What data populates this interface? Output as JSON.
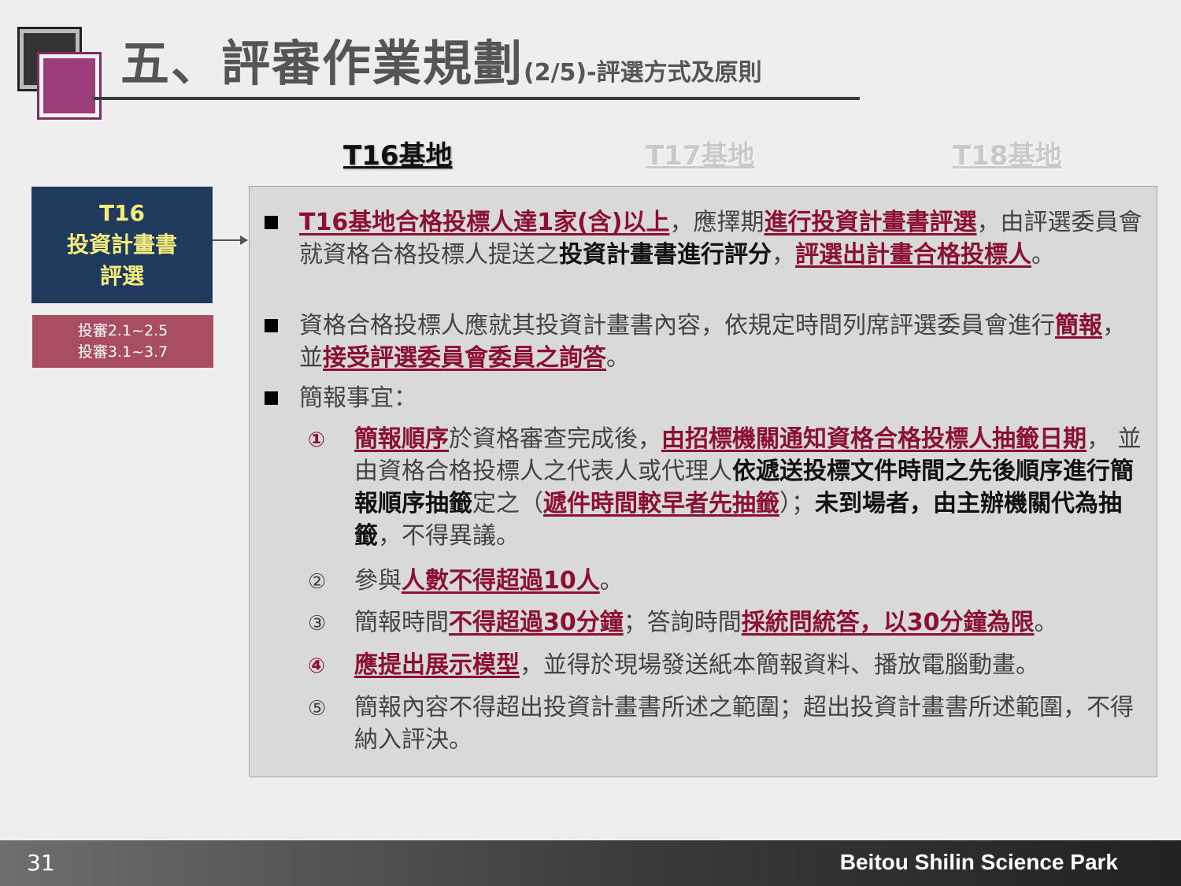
{
  "header": {
    "title_main": "五、評審作業規劃",
    "title_sub": "(2/5)-評選方式及原則"
  },
  "tabs": [
    {
      "label": "T16基地",
      "active": true
    },
    {
      "label": "T17基地",
      "active": false
    },
    {
      "label": "T18基地",
      "active": false
    }
  ],
  "stage": {
    "line1": "T16",
    "line2": "投資計畫書",
    "line3": "評選"
  },
  "refs": {
    "line1": "投審2.1~2.5",
    "line2": "投審3.1~3.7"
  },
  "bullets": {
    "b1": {
      "s1": "T16基地合格投標人達1家(含)以上",
      "s2": "，應擇期",
      "s3": "進行投資計畫書評選",
      "s4": "，由評選委員會就資格合格投標人提送之",
      "s5": "投資計畫書進行評分",
      "s6": "，",
      "s7": "評選出計畫合格投標人",
      "s8": "。"
    },
    "b2": {
      "s1": "資格合格投標人應就其投資計畫書內容，依規定時間列席評選委員會進行",
      "s2": "簡報",
      "s3": "，並",
      "s4": "接受評選委員會委員之詢答",
      "s5": "。"
    },
    "b3": {
      "s1": "簡報事宜："
    }
  },
  "items": [
    {
      "marker": "①",
      "s1": "簡報順序",
      "s2": "於資格審查完成後，",
      "s3": "由招標機關通知資格合格投標人抽籤日期",
      "s4": "，  並由資格合格投標人之代表人或代理人",
      "s5": "依遞送投標文件時間之先後順序進行簡報順序抽籤",
      "s6": "定之（",
      "s7": "遞件時間較早者先抽籤",
      "s8": "）；",
      "s9": "未到場者，由主辦機關代為抽籤",
      "s10": "，不得異議。"
    },
    {
      "marker": "②",
      "s1": "參與",
      "s2": "人數不得超過10人",
      "s3": "。"
    },
    {
      "marker": "③",
      "s1": "簡報時間",
      "s2": "不得超過30分鐘",
      "s3": "；答詢時間",
      "s4": "採統問統答，以30分鐘為限",
      "s5": "。"
    },
    {
      "marker": "④",
      "s1": "應提出展示模型",
      "s2": "，並得於現場發送紙本簡報資料、播放電腦動畫。"
    },
    {
      "marker": "⑤",
      "s1": "簡報內容不得超出投資計畫書所述之範圍；超出投資計畫書所述範圍，不得納入評決。"
    }
  ],
  "footer": {
    "page": "31",
    "brand": "Beitou Shilin Science Park"
  },
  "colors": {
    "accent_red": "#8b1033",
    "stage_bg": "#1f3a5c",
    "stage_text": "#f4ec7c",
    "ref_bg": "#a94e62",
    "logo": "#9b3d78"
  }
}
